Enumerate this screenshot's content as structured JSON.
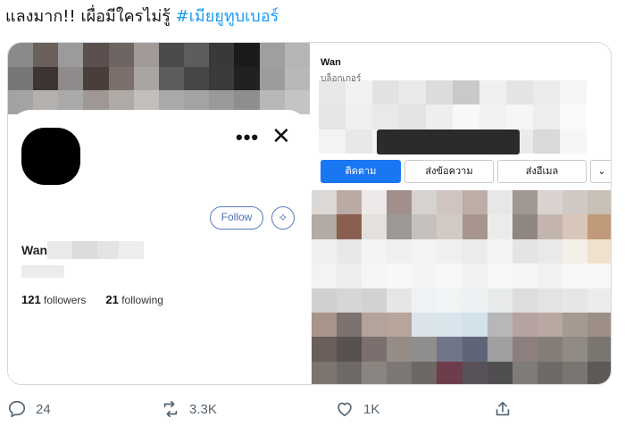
{
  "tweet": {
    "text": "แลงมาก!! เผื่อมีใครไม่รู้",
    "hashtag": "#เมียยูทูบเบอร์"
  },
  "left_card": {
    "name_prefix": "Wan",
    "follow_label": "Follow",
    "followers_count": "121",
    "followers_label": "followers",
    "following_count": "21",
    "following_label": "following",
    "icons": [
      "more-icon",
      "close-icon",
      "sparkle-icon"
    ]
  },
  "right_card": {
    "name_prefix": "Wan",
    "subtitle": "บล็อกเกอร์",
    "buttons": {
      "follow": "ติดตาม",
      "message": "ส่งข้อความ",
      "email": "ส่งอีเมล",
      "more": "⌄"
    },
    "accent": "#1a77f2"
  },
  "actions": {
    "replies": "24",
    "retweets": "3.3K",
    "likes": "1K"
  },
  "mosaic_colors": {
    "top": [
      "#8a8a8a",
      "#6b5f5a",
      "#9b9b9b",
      "#5a4f4c",
      "#6e6562",
      "#a19a98",
      "#4d4a4a",
      "#5e5c5c",
      "#393939",
      "#1b1b1b",
      "#9f9f9f",
      "#b5b5b5",
      "#777",
      "#3d3434",
      "#8f8b8b",
      "#4a3e3b",
      "#7b706b",
      "#a9a5a3",
      "#5f5c5c",
      "#474545",
      "#3a3a3a",
      "#212121",
      "#9c9c9c",
      "#b8b8b8",
      "#a3a3a3",
      "#b4b0ae",
      "#a9a9a9",
      "#9e9793",
      "#b0aaa7",
      "#c2bebc",
      "#a9a9a9",
      "#a3a3a3",
      "#999",
      "#8e8e8e",
      "#b7b7b7",
      "#c4c4c4"
    ],
    "right_top": [
      "#e8e8e8",
      "#f2f2f2",
      "#e2e2e2",
      "#eaeaea",
      "#dcdcdc",
      "#c9c9c9",
      "#f0f0f0",
      "#e4e4e4",
      "#ececec",
      "#f5f5f5",
      "#e6e6e6",
      "#f0f0f0",
      "#e9e9e9",
      "#e3e3e3",
      "#eeeeee",
      "#f8f8f8",
      "#f1f1f1",
      "#f6f6f6",
      "#ededed",
      "#fafafa",
      "#f3f3f3",
      "#e8e8e8",
      "#f5f5f5",
      "#ececec",
      "#f7f7f7",
      "#fbfbfb",
      "#f3f3f3",
      "#ebebeb",
      "#d9d9d9",
      "#f6f6f6"
    ],
    "bottom": [
      "#dbd8d6",
      "#b9aaa3",
      "#ede9e9",
      "#a18f8b",
      "#d7d1cf",
      "#cfc4bf",
      "#bcaea6",
      "#e7e7e7",
      "#a29892",
      "#d9d2cf",
      "#cfc8c3",
      "#c8bfb6",
      "#b4aaa4",
      "#8a5f50",
      "#e4e0de",
      "#9e9895",
      "#c7c1bd",
      "#d1c9c4",
      "#a7958d",
      "#ebebeb",
      "#8f8581",
      "#c3b5ae",
      "#d8c7b8",
      "#c09a78",
      "#f0f0f0",
      "#e8e8e8",
      "#f4f4f4",
      "#efefef",
      "#f3f3f3",
      "#efefef",
      "#ebebeb",
      "#f3f3f3",
      "#e4e4e4",
      "#e9e9e9",
      "#f4efe7",
      "#efe2cc",
      "#f3f3f3",
      "#eeeeee",
      "#f6f6f6",
      "#f8f8f8",
      "#f4f4f4",
      "#f8f8f8",
      "#f1f1f1",
      "#f7f7f7",
      "#f5f5f5",
      "#f2f2f2",
      "#f7f7f7",
      "#f7f7f7",
      "#d1cfcf",
      "#d6d6d6",
      "#d3d2d2",
      "#e6e6e6",
      "#eef2f4",
      "#f1f4f5",
      "#edf1f3",
      "#e8eaea",
      "#dedcdc",
      "#e3e3e3",
      "#e6e6e6",
      "#ececec",
      "#a8948a",
      "#7d726f",
      "#b4a39b",
      "#b7a49b",
      "#dbe5e9",
      "#d9e5ec",
      "#d3e1ea",
      "#b7b7b7",
      "#b6a3a1",
      "#b9a8a1",
      "#a59a8f",
      "#9d8f88",
      "#6a5f5a",
      "#575150",
      "#7b706d",
      "#958c86",
      "#8e8e8e",
      "#707588",
      "#5f6578",
      "#a0a0a0",
      "#8c7f7e",
      "#857d78",
      "#8f8a82",
      "#7b7570",
      "#7b746f",
      "#6f6a68",
      "#8a8580",
      "#7d7775",
      "#6d6863",
      "#6d3d4b",
      "#585258",
      "#4f4d4f",
      "#7e7b79",
      "#6e6a68",
      "#797570",
      "#5c5957"
    ]
  }
}
